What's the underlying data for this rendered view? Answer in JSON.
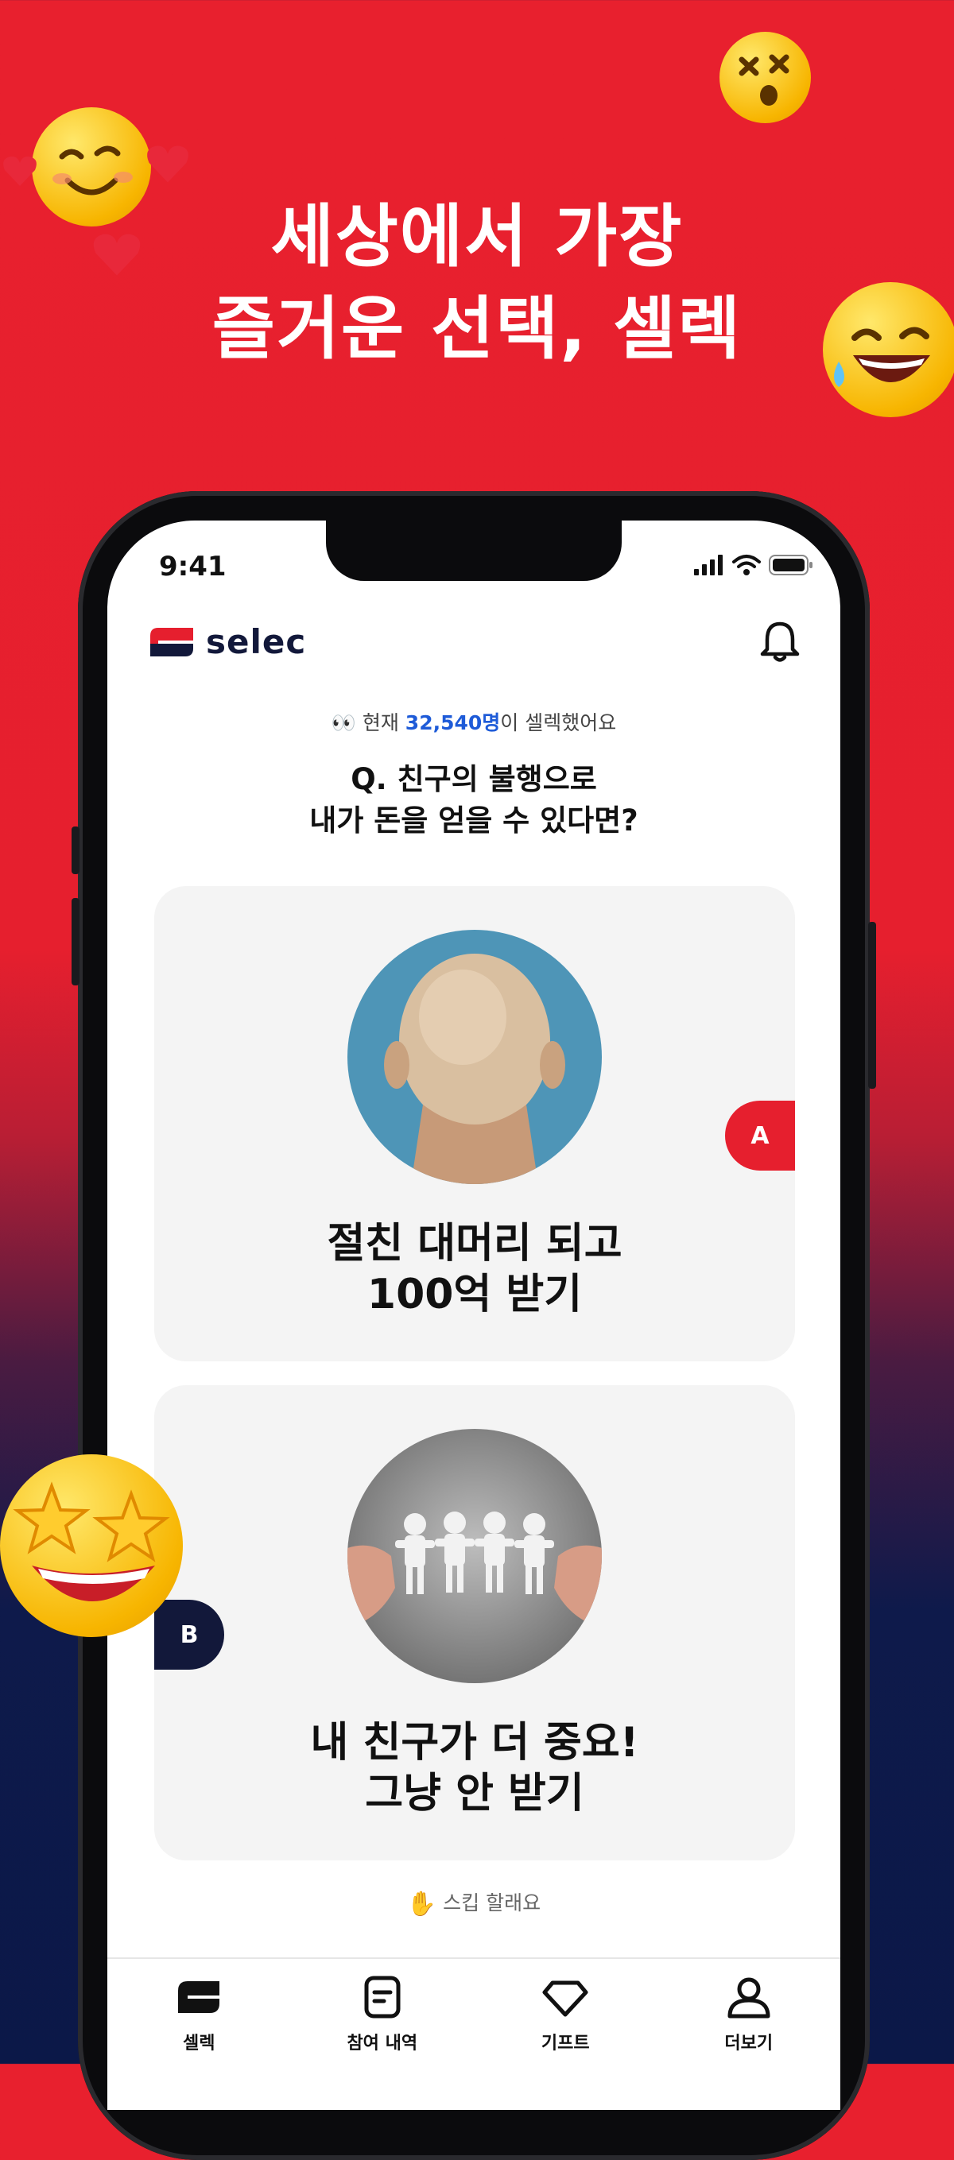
{
  "hero": {
    "line1": "세상에서 가장",
    "line2": "즐거운 선택, 셀렉"
  },
  "colors": {
    "brand_red": "#E61F2E",
    "brand_navy": "#12183A",
    "link_blue": "#1E5BD8"
  },
  "status_bar": {
    "time": "9:41",
    "icons": [
      "signal-icon",
      "wifi-icon",
      "battery-icon"
    ]
  },
  "app": {
    "logo_text": "selec",
    "bell_icon": "bell-icon"
  },
  "live": {
    "prefix": "👀 현재 ",
    "count": "32,540명",
    "suffix": "이 셀렉했어요"
  },
  "question": {
    "line1": "Q.  친구의 불행으로",
    "line2": "내가 돈을 얻을 수 있다면?"
  },
  "options": [
    {
      "badge": "A",
      "line1": "절친 대머리 되고",
      "line2": "100억 받기"
    },
    {
      "badge": "B",
      "line1": "내 친구가 더 중요!",
      "line2": "그냥 안 받기"
    }
  ],
  "skip": {
    "label": "스킵 할래요"
  },
  "tabs": [
    {
      "label": "셀렉",
      "icon": "selec-logo-icon"
    },
    {
      "label": "참여 내역",
      "icon": "history-icon"
    },
    {
      "label": "기프트",
      "icon": "gift-diamond-icon"
    },
    {
      "label": "더보기",
      "icon": "profile-icon"
    }
  ]
}
